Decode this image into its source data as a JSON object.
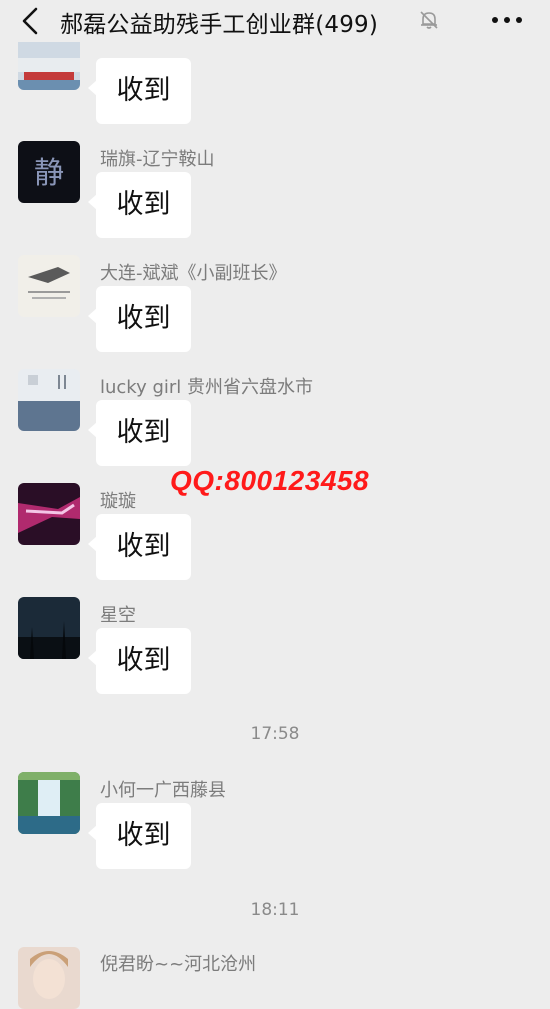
{
  "header": {
    "title": "郝磊公益助残手工创业群(499)",
    "back_icon": "chevron-left-icon",
    "mute_icon": "bell-muted-icon",
    "more_icon": "more-dots-icon"
  },
  "watermark": "QQ:800123458",
  "messages": [
    {
      "sender": "",
      "text": "收到"
    },
    {
      "sender": "瑞旗-辽宁鞍山",
      "text": "收到"
    },
    {
      "sender": "大连-斌斌《小副班长》",
      "text": "收到"
    },
    {
      "sender": "lucky girl 贵州省六盘水市",
      "text": "收到"
    },
    {
      "sender": "璇璇",
      "text": "收到"
    },
    {
      "sender": "星空",
      "text": "收到"
    },
    {
      "sender": "小何一广西藤县",
      "text": "收到"
    },
    {
      "sender": "倪君盼~~河北沧州",
      "text": ""
    }
  ],
  "timestamps": [
    "17:58",
    "18:11"
  ],
  "colors": {
    "background": "#ededed",
    "bubble": "#ffffff",
    "watermark": "#ff1a1a",
    "sender_name": "#7c7c7c"
  }
}
